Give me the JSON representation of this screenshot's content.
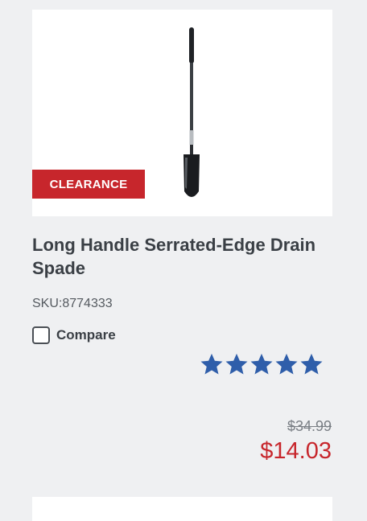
{
  "product": {
    "badge": "CLEARANCE",
    "title": "Long Handle Serrated-Edge Drain Spade",
    "sku": "SKU:8774333",
    "compare_label": "Compare",
    "rating_stars": 5,
    "original_price": "$34.99",
    "sale_price": "$14.03"
  },
  "colors": {
    "clearance_badge": "#c7262c",
    "sale_price": "#c7262c",
    "rating_star": "#2f5eaa"
  }
}
